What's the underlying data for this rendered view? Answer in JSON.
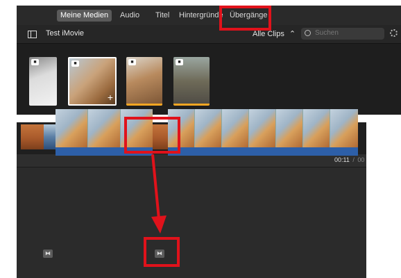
{
  "tabs": [
    "Meine Medien",
    "Audio",
    "Titel",
    "Hintergründe",
    "Übergänge"
  ],
  "project": {
    "title": "Test iMovie"
  },
  "filter": {
    "label": "Alle Clips",
    "chevron": "⌃"
  },
  "search": {
    "placeholder": "Suchen"
  },
  "timeline": {
    "time": "00:11",
    "separator": "/",
    "duration_partial": "00"
  },
  "icons": {
    "sidebar": "sidebar-toggle-icon",
    "search": "search-icon",
    "settings": "gear-icon",
    "camera": "camera-icon",
    "add": "plus-icon",
    "transition": "transition-marker-icon"
  },
  "glyphs": {
    "plus": "+",
    "transition": "⧓"
  },
  "colors": {
    "highlight": "#e0121b",
    "accent": "#f5a623",
    "selection": "#5a5a5a"
  }
}
